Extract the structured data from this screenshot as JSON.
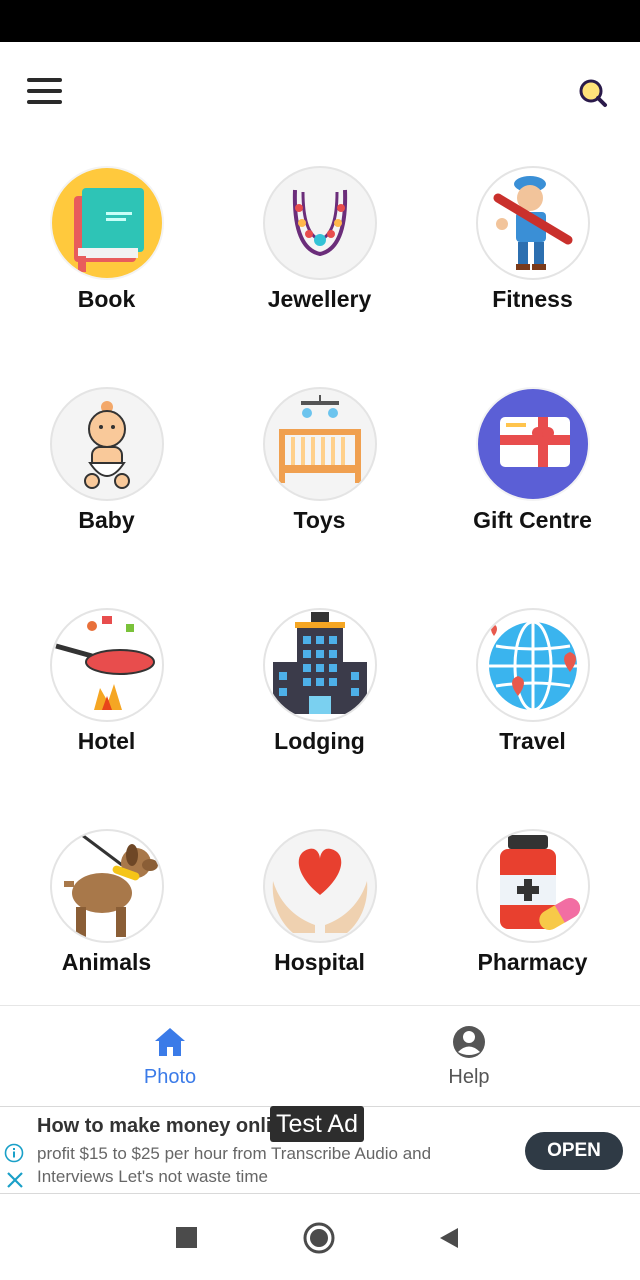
{
  "categories": [
    {
      "label": "Book",
      "icon": "book-icon"
    },
    {
      "label": "Jewellery",
      "icon": "necklace-icon"
    },
    {
      "label": "Fitness",
      "icon": "plumber-icon"
    },
    {
      "label": "Baby",
      "icon": "baby-icon"
    },
    {
      "label": "Toys",
      "icon": "crib-icon"
    },
    {
      "label": "Gift Centre",
      "icon": "gift-card-icon"
    },
    {
      "label": "Hotel",
      "icon": "frying-pan-icon"
    },
    {
      "label": "Lodging",
      "icon": "hotel-building-icon"
    },
    {
      "label": "Travel",
      "icon": "globe-pin-icon"
    },
    {
      "label": "Animals",
      "icon": "dog-icon"
    },
    {
      "label": "Hospital",
      "icon": "heart-hands-icon"
    },
    {
      "label": "Pharmacy",
      "icon": "medicine-icon"
    }
  ],
  "bottom_nav": {
    "photo_label": "Photo",
    "help_label": "Help",
    "active_color": "#3b7be8",
    "inactive_color": "#555555"
  },
  "ad": {
    "title": "How to make money onli",
    "body": "profit $15 to $25 per hour from Transcribe Audio and Interviews Let's not waste time",
    "cta": "OPEN",
    "badge": "Test Ad"
  }
}
